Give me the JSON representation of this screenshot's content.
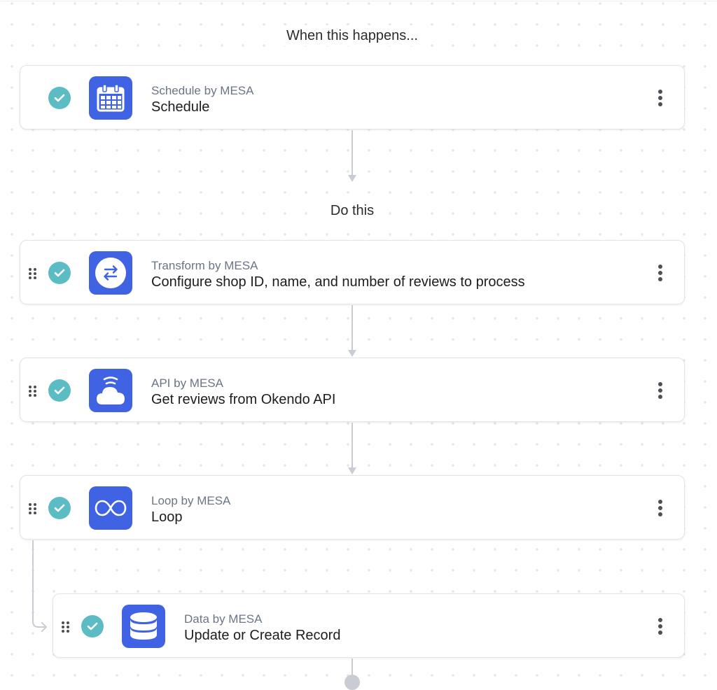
{
  "trigger_section": {
    "label": "When this happens..."
  },
  "action_section": {
    "label": "Do this"
  },
  "trigger": {
    "app_name": "Schedule by MESA",
    "title": "Schedule",
    "icon": "calendar-icon",
    "status": "complete",
    "draggable": false
  },
  "steps": [
    {
      "app_name": "Transform by MESA",
      "title": "Configure shop ID, name, and number of reviews to process",
      "icon": "transform-arrows-icon",
      "status": "complete",
      "draggable": true
    },
    {
      "app_name": "API by MESA",
      "title": "Get reviews from Okendo API",
      "icon": "cloud-api-icon",
      "status": "complete",
      "draggable": true
    },
    {
      "app_name": "Loop by MESA",
      "title": "Loop",
      "icon": "infinity-loop-icon",
      "status": "complete",
      "draggable": true
    },
    {
      "app_name": "Data by MESA",
      "title": "Update or Create Record",
      "icon": "database-icon",
      "status": "complete",
      "draggable": true,
      "nested_in_loop": true
    }
  ],
  "colors": {
    "app_icon_bg": "#3f63e3",
    "check_bg": "#5cbcc4",
    "connector": "#c9ccd2",
    "app_name_text": "#6b7585"
  }
}
